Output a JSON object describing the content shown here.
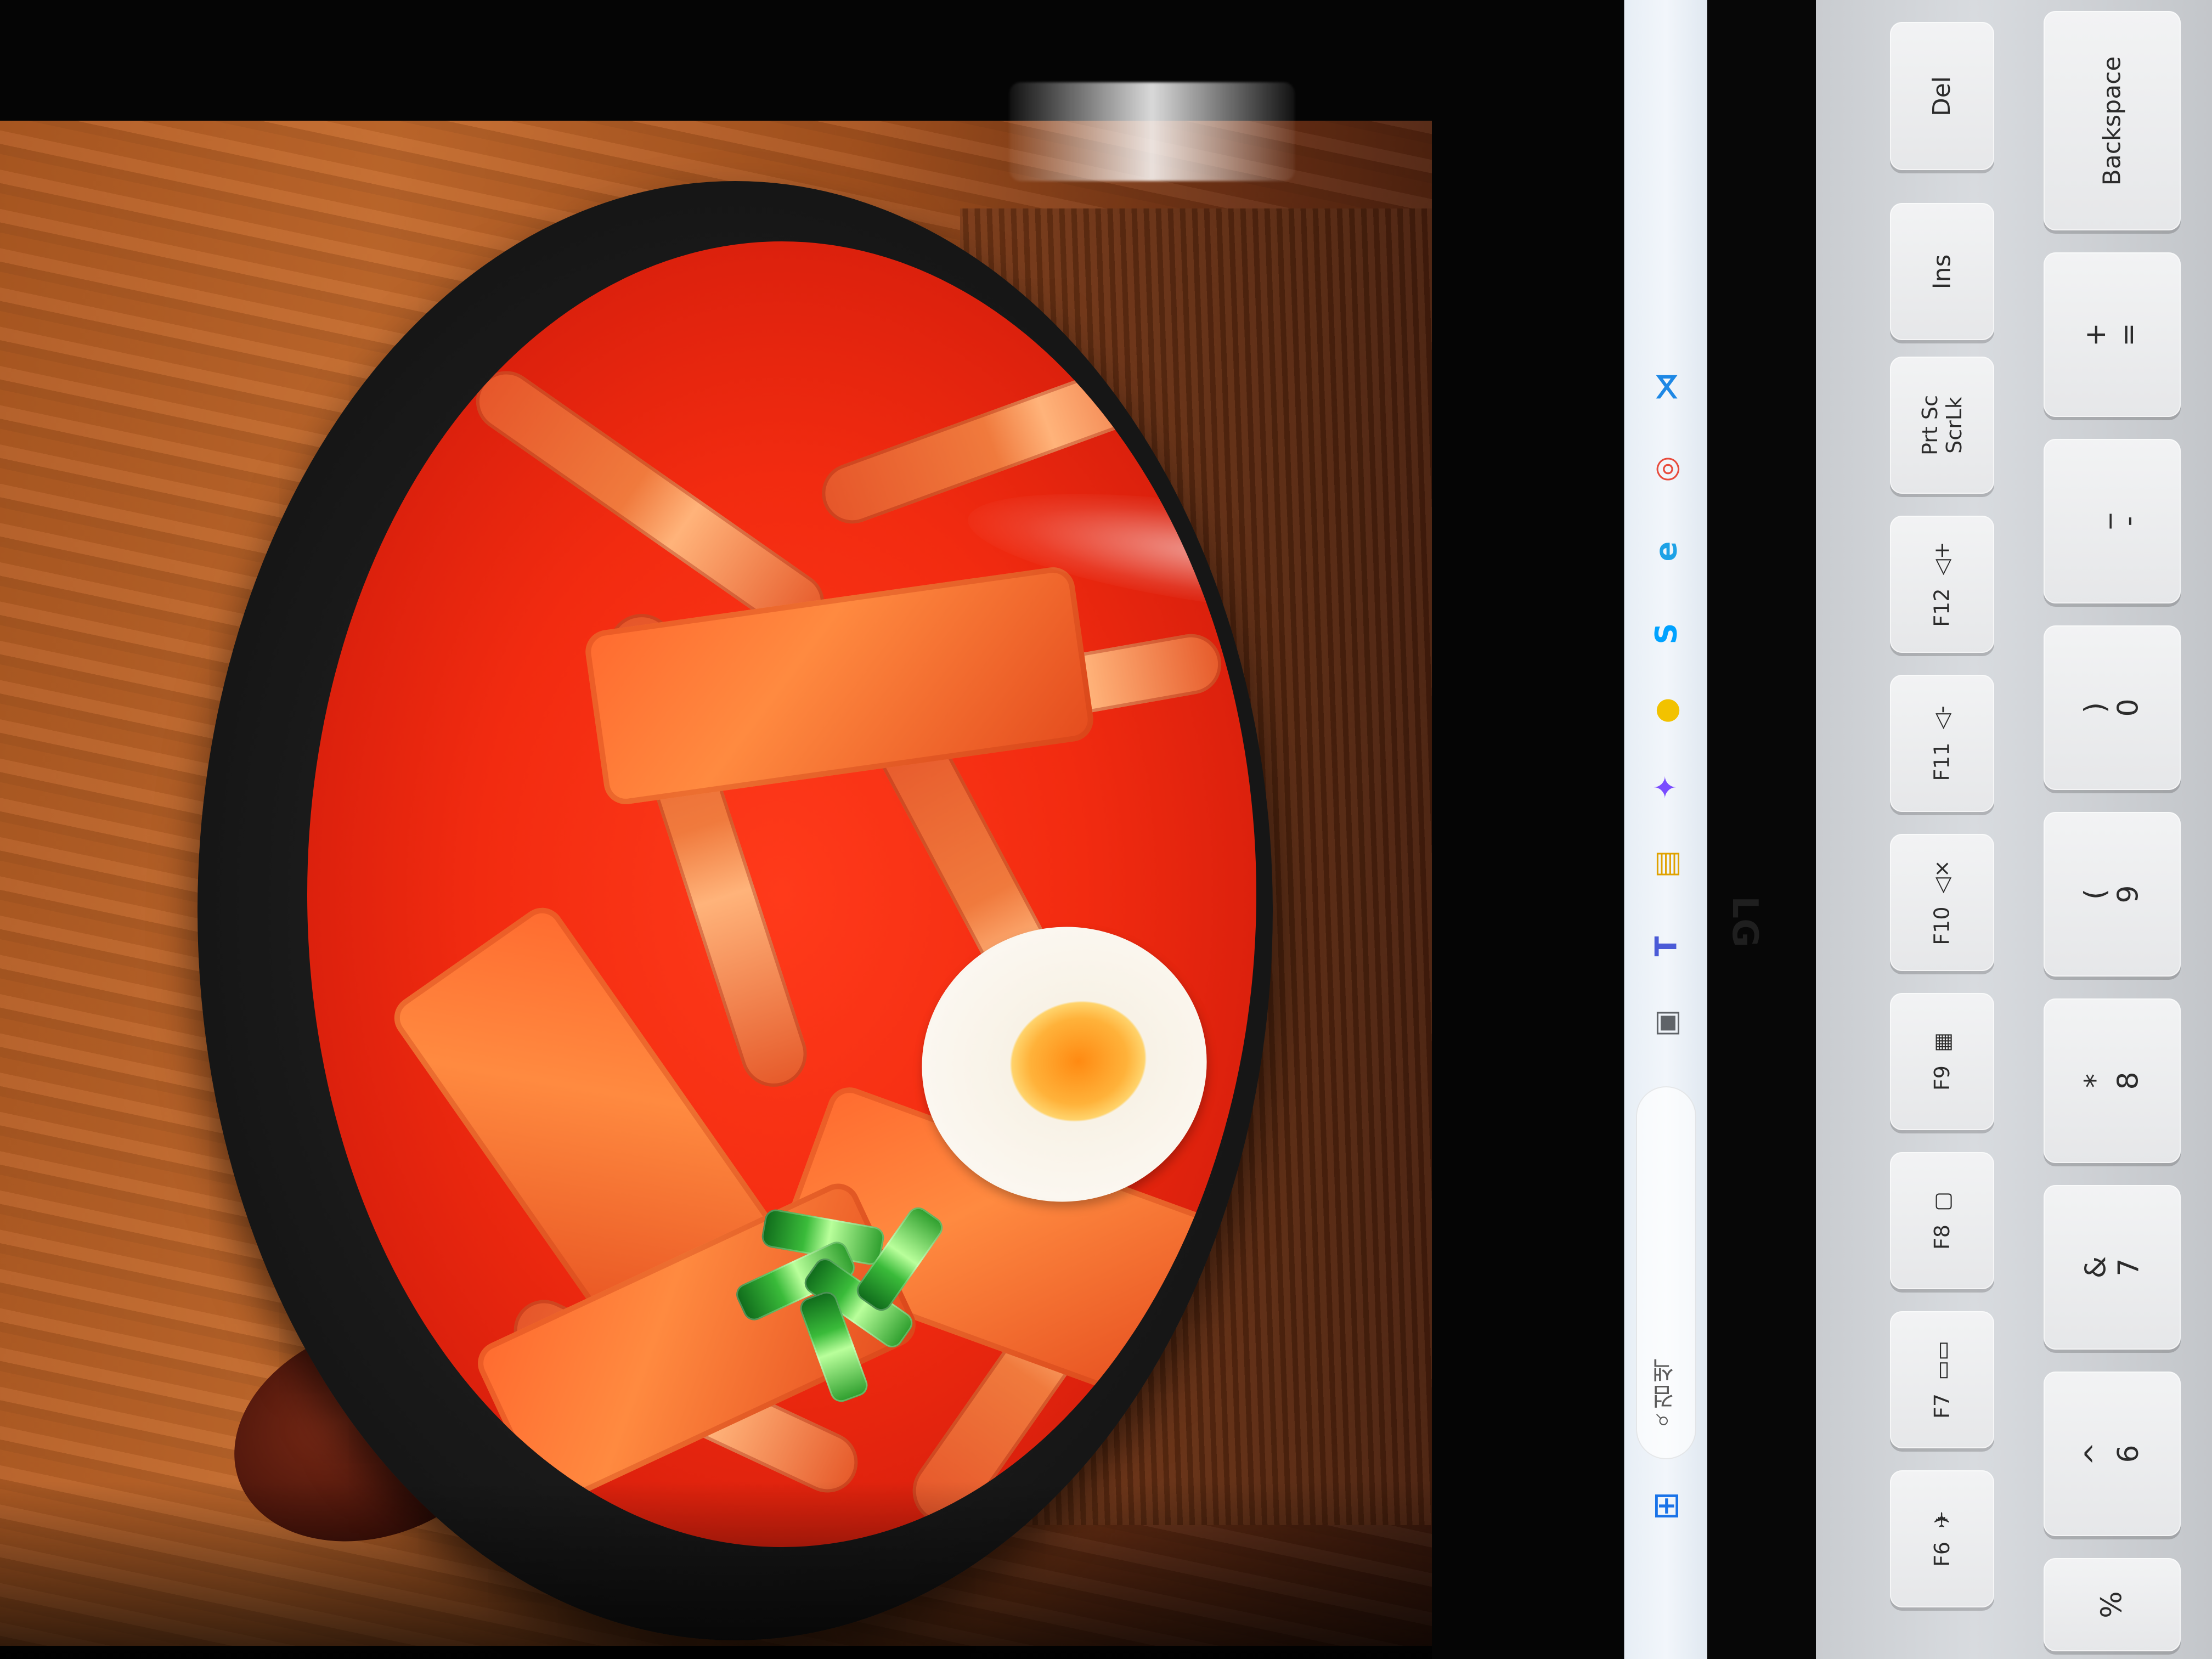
{
  "taskbar": {
    "search_label": "검색",
    "apps": [
      {
        "name": "start-menu-icon",
        "glyph": "⊞",
        "color": "#1a73e8"
      },
      {
        "name": "task-view-icon",
        "glyph": "▣",
        "color": "#5f6368"
      },
      {
        "name": "teams-icon",
        "glyph": "T",
        "color": "#4b5bd7"
      },
      {
        "name": "file-explorer-icon",
        "glyph": "▤",
        "color": "#e0a200"
      },
      {
        "name": "copilot-icon",
        "glyph": "✦",
        "color": "#7a4cff"
      },
      {
        "name": "kakaotalk-icon",
        "glyph": "●",
        "color": "#f2c200"
      },
      {
        "name": "app-s-icon",
        "glyph": "S",
        "color": "#00a2ff"
      },
      {
        "name": "edge-icon",
        "glyph": "e",
        "color": "#1ea2e6"
      },
      {
        "name": "chrome-icon",
        "glyph": "◎",
        "color": "#e84b3c"
      },
      {
        "name": "vscode-icon",
        "glyph": "⋊",
        "color": "#1e88e5"
      }
    ]
  },
  "keyboard": {
    "brand": "LG",
    "keys": [
      {
        "name": "key-del",
        "label": "Del"
      },
      {
        "name": "key-backspace",
        "label": "Backspace"
      },
      {
        "name": "key-ins",
        "label": "Ins"
      },
      {
        "name": "key-equal-plus",
        "label": "+\n="
      },
      {
        "name": "key-prtsc-scrlk",
        "label": "Prt Sc\nScrLk"
      },
      {
        "name": "key-minus-underscore",
        "label": "_\n-"
      },
      {
        "name": "key-f12",
        "label": "F12  ◁+"
      },
      {
        "name": "key-0-paren",
        "label": ")\n0"
      },
      {
        "name": "key-f11",
        "label": "F11  ◁-"
      },
      {
        "name": "key-9-paren",
        "label": "(\n9"
      },
      {
        "name": "key-f10",
        "label": "F10  ◁×"
      },
      {
        "name": "key-8-star",
        "label": "*\n8"
      },
      {
        "name": "key-f9",
        "label": "F9  ▦"
      },
      {
        "name": "key-7-amp",
        "label": "&\n7"
      },
      {
        "name": "key-f8",
        "label": "F8  ▢"
      },
      {
        "name": "key-6-caret",
        "label": "^\n6"
      },
      {
        "name": "key-f7",
        "label": "F7  ▭▭"
      },
      {
        "name": "key-5-percent",
        "label": "%"
      },
      {
        "name": "key-f6",
        "label": "F6  ✈"
      }
    ]
  },
  "photo": {
    "accent_soup": "#ff3a1a",
    "wood_color": "#c46a2c",
    "bowl_color": "#161616"
  }
}
